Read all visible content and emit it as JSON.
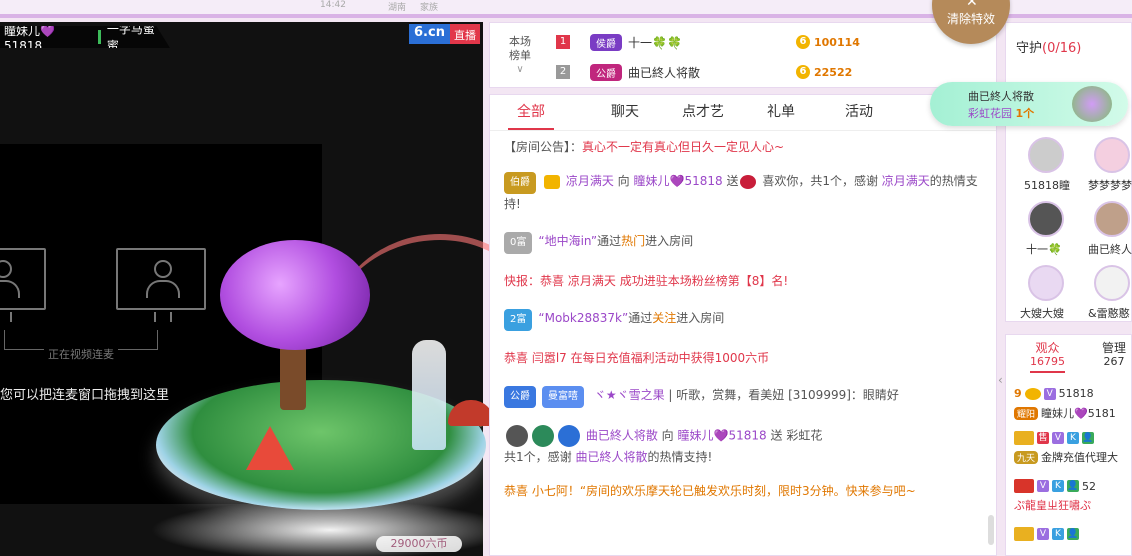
{
  "top": {
    "time": "14:42",
    "location": "湖南",
    "gender": "家族",
    "clear_effects": "清除特效"
  },
  "video": {
    "host_name": "瞳妹儿💜51818",
    "tag_text": "一字马蜜蜜",
    "logo_main": "6.cn",
    "logo_live": "直播",
    "link_text": "正在视频连麦",
    "drag_hint": "您可以把连麦窗口拖拽到这里",
    "gift_price": "29000六币"
  },
  "rank": {
    "label_line1": "本场",
    "label_line2": "榜单",
    "rows": [
      {
        "no": "1",
        "badge": "侯爵",
        "name": "十一🍀🍀",
        "value": "100114"
      },
      {
        "no": "2",
        "badge": "公爵",
        "name": "曲已終人将散",
        "value": "22522"
      }
    ]
  },
  "chat": {
    "tabs": [
      "全部",
      "聊天",
      "点才艺",
      "礼单",
      "活动"
    ],
    "messages": {
      "announce_label": "【房间公告】：",
      "announce_text": "真心不一定有真心但日久一定见人心~",
      "m1_badge": "伯爵",
      "m1_user": "凉月满天",
      "m1_to": "向",
      "m1_target": "瞳妹儿💜51818",
      "m1_send": "送",
      "m1_rest": "喜欢你，共1个，感谢",
      "m1_user2": "凉月满天",
      "m1_end": "的热情支持!",
      "m2_badge": "0富",
      "m2_user": "“地中海in”",
      "m2_via": "通过",
      "m2_link": "热门",
      "m2_end": "进入房间",
      "m3_text": "快报：恭喜",
      "m3_user": "凉月满天",
      "m3_end": "成功进驻本场粉丝榜第【8】名!",
      "m4_badge": "2富",
      "m4_user": "“Mobk28837k”",
      "m4_via": "通过",
      "m4_link": "关注",
      "m4_end": "进入房间",
      "m5_text": "恭喜 闫嚣l7 在每日充值福利活动中获得1000六币",
      "m6_badge": "公爵",
      "m6_fan": "曼富嘻",
      "m6_user": "ヾ★ヾ雪之果",
      "m6_text": "| 听歌，赏舞，看美妞 [3109999]：眼睛好",
      "m7_user": "曲已終人将散",
      "m7_to": "向",
      "m7_target": "瞳妹儿💜51818",
      "m7_send": "送",
      "m7_gift": "彩虹花",
      "m7_line2a": "共1个，感谢",
      "m7_user2": "曲已終人将散",
      "m7_end": "的热情支持!",
      "m8_text": "恭喜 小七阿！“房间的欢乐摩天轮已触发欢乐时刻，限时3分钟。快来参与吧~"
    }
  },
  "guard": {
    "title": "守护",
    "count": "(0/16)",
    "members": [
      "51818瞳",
      "梦梦梦梦",
      "十一🍀",
      "曲已終人",
      "大嫂大嫂",
      "&雷憨憨"
    ]
  },
  "viewers": {
    "tab_audience": "观众",
    "audience_count": "16795",
    "tab_admin": "管理",
    "admin_count": "267",
    "rows": [
      {
        "level": "9",
        "name": "51818"
      },
      {
        "tag": "耀阳",
        "name": "瞳妹儿💜5181"
      },
      {
        "tag": "九天",
        "name": "金牌充值代理大"
      },
      {
        "tag": "",
        "name": "ぷ龍皇ㄓ狂嘯ぷ"
      },
      {
        "tag": "",
        "name": ""
      }
    ],
    "extra_52": "52"
  },
  "gift_popup": {
    "sender": "曲已終人将散",
    "gift": "彩虹花园",
    "qty": "1个"
  },
  "colors": {
    "accent": "#e0364a",
    "brand_purple": "#9b48c8",
    "coin": "#f2b400"
  }
}
